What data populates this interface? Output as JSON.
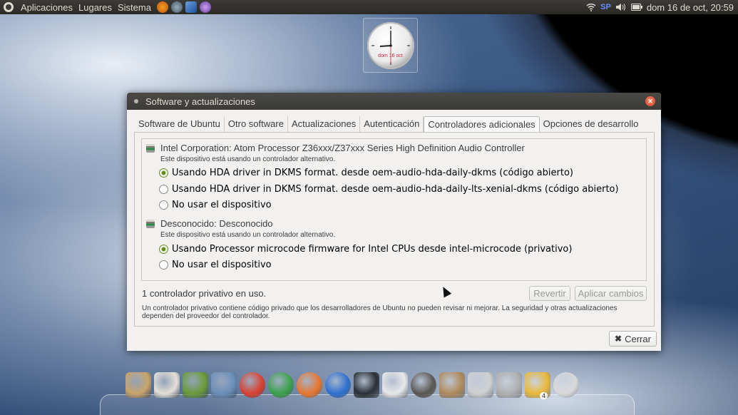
{
  "top_panel": {
    "menus": [
      "Aplicaciones",
      "Lugares",
      "Sistema"
    ],
    "keyboard_layout": "SP",
    "datetime": "dom 16 de oct, 20:59"
  },
  "clock_widget": {
    "date_label": "dom 16 oct"
  },
  "window": {
    "title": "Software y actualizaciones",
    "tabs": [
      {
        "label": "Software de Ubuntu"
      },
      {
        "label": "Otro software"
      },
      {
        "label": "Actualizaciones"
      },
      {
        "label": "Autenticación"
      },
      {
        "label": "Controladores adicionales",
        "active": true
      },
      {
        "label": "Opciones de desarrollo"
      }
    ],
    "devices": [
      {
        "name": "Intel Corporation: Atom Processor Z36xxx/Z37xxx Series High Definition Audio Controller",
        "status": "Este dispositivo está usando un controlador alternativo.",
        "options": [
          {
            "label": "Usando HDA driver in DKMS format. desde oem-audio-hda-daily-dkms (código abierto)",
            "selected": true
          },
          {
            "label": "Usando HDA driver in DKMS format. desde oem-audio-hda-daily-lts-xenial-dkms (código abierto)",
            "selected": false
          },
          {
            "label": "No usar el dispositivo",
            "selected": false
          }
        ]
      },
      {
        "name": "Desconocido: Desconocido",
        "status": "Este dispositivo está usando un controlador alternativo.",
        "options": [
          {
            "label": "Usando Processor microcode firmware for Intel CPUs desde intel-microcode (privativo)",
            "selected": true
          },
          {
            "label": "No usar el dispositivo",
            "selected": false
          }
        ]
      }
    ],
    "footer_status": "1 controlador privativo en uso.",
    "revert_label": "Revertir",
    "apply_label": "Aplicar cambios",
    "note": "Un controlador privativo contiene código privado que los desarrolladores de Ubuntu no pueden revisar ni mejorar. La seguridad y otras actualizaciones dependen del proveedor del controlador.",
    "close_label": "Cerrar"
  },
  "dock": {
    "items": [
      {
        "name": "downloads-icon",
        "color": "#c9a46a"
      },
      {
        "name": "home-folder-icon",
        "color": "#e4dfd6"
      },
      {
        "name": "file-manager-icon",
        "color": "#6a9c3a"
      },
      {
        "name": "remote-desktop-icon",
        "color": "#6c8fb8"
      },
      {
        "name": "chrome-icon",
        "color": "#d9402f"
      },
      {
        "name": "network-icon",
        "color": "#3aa04a"
      },
      {
        "name": "firefox-icon",
        "color": "#e8772e"
      },
      {
        "name": "help-icon",
        "color": "#2e6fd0"
      },
      {
        "name": "terminal-icon",
        "color": "#2b3036"
      },
      {
        "name": "browser-window-icon",
        "color": "#e8e8e8"
      },
      {
        "name": "software-center-icon",
        "color": "#5a5752"
      },
      {
        "name": "files-icon",
        "color": "#b08a5a"
      },
      {
        "name": "camera-icon",
        "color": "#cfcfcf"
      },
      {
        "name": "drive-icon",
        "color": "#b0b0b0"
      },
      {
        "name": "updates-icon",
        "color": "#e9b93a",
        "badge": "4"
      },
      {
        "name": "power-icon",
        "color": "#d8d8d8"
      }
    ]
  }
}
